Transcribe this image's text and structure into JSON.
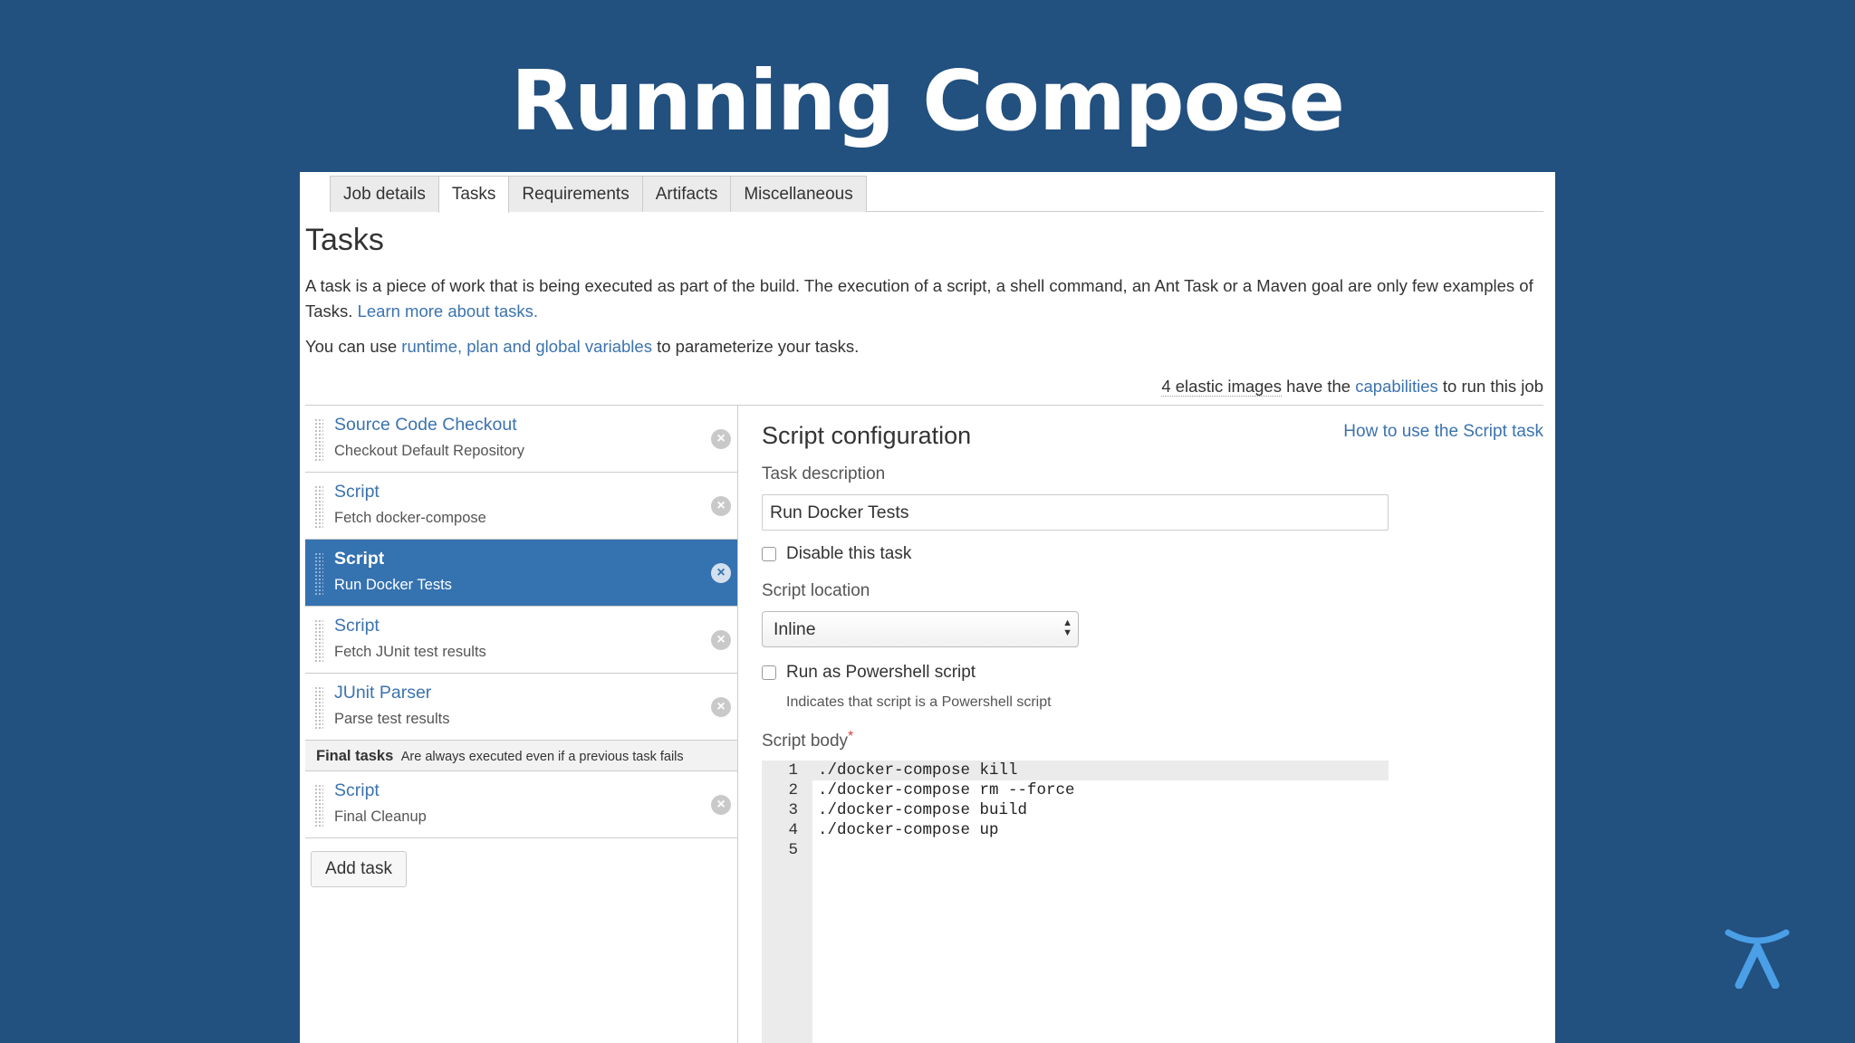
{
  "slide": {
    "title": "Running Compose"
  },
  "tabs": [
    {
      "label": "Job details"
    },
    {
      "label": "Tasks"
    },
    {
      "label": "Requirements"
    },
    {
      "label": "Artifacts"
    },
    {
      "label": "Miscellaneous"
    }
  ],
  "tasks_page": {
    "heading": "Tasks",
    "description": "A task is a piece of work that is being executed as part of the build. The execution of a script, a shell command, an Ant Task or a Maven goal are only few examples of Tasks.",
    "learn_more_link": "Learn more about tasks.",
    "variables_prefix": "You can use",
    "variables_link": "runtime, plan and global variables",
    "variables_suffix": "to parameterize your tasks.",
    "elastic_count": "4 elastic images",
    "elastic_mid": "have the",
    "capabilities_link": "capabilities",
    "elastic_suffix": "to run this job"
  },
  "task_list": [
    {
      "title": "Source Code Checkout",
      "subtitle": "Checkout Default Repository"
    },
    {
      "title": "Script",
      "subtitle": "Fetch docker-compose"
    },
    {
      "title": "Script",
      "subtitle": "Run Docker Tests"
    },
    {
      "title": "Script",
      "subtitle": "Fetch JUnit test results"
    },
    {
      "title": "JUnit Parser",
      "subtitle": "Parse test results"
    }
  ],
  "final_tasks": {
    "label": "Final tasks",
    "note": "Are always executed even if a previous task fails",
    "items": [
      {
        "title": "Script",
        "subtitle": "Final Cleanup"
      }
    ]
  },
  "add_task_label": "Add task",
  "config": {
    "title": "Script configuration",
    "help_link": "How to use the Script task",
    "task_description_label": "Task description",
    "task_description_value": "Run Docker Tests",
    "disable_label": "Disable this task",
    "script_location_label": "Script location",
    "script_location_value": "Inline",
    "powershell_label": "Run as Powershell script",
    "powershell_hint": "Indicates that script is a Powershell script",
    "script_body_label": "Script body",
    "required_mark": "*",
    "code_lines": [
      {
        "num": "1",
        "text": "./docker-compose kill"
      },
      {
        "num": "2",
        "text": "./docker-compose rm --force"
      },
      {
        "num": "3",
        "text": "./docker-compose build"
      },
      {
        "num": "4",
        "text": "./docker-compose up"
      },
      {
        "num": "5",
        "text": ""
      }
    ]
  },
  "colors": {
    "slide_bg": "#22507f",
    "selected_task": "#3572b0",
    "link": "#3b73af",
    "logo": "#4a9fe6"
  },
  "icons": {
    "remove": "close-circle-icon",
    "drag": "drag-handle-icon",
    "logo": "atlassian-logo-icon"
  }
}
